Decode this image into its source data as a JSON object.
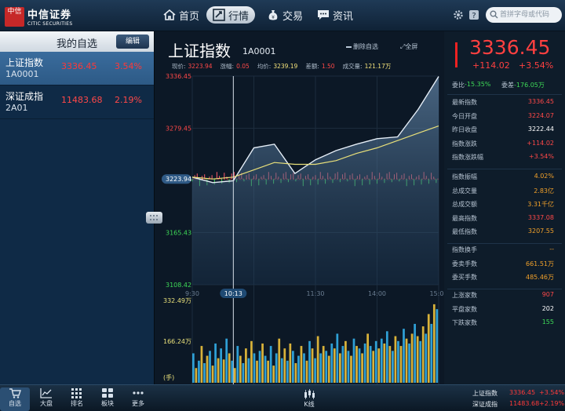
{
  "app": {
    "logo_seal": "中信",
    "brand_cn": "中信证券",
    "brand_en": "CITIC SECURITIES"
  },
  "nav": {
    "home": "首页",
    "market": "行情",
    "trade": "交易",
    "news": "资讯"
  },
  "search": {
    "placeholder": "首拼字母或代码"
  },
  "watchlist": {
    "title": "我的自选",
    "edit_label": "编辑",
    "items": [
      {
        "name": "上证指数",
        "code": "1A0001",
        "price": "3336.45",
        "change_pct": "3.54%"
      },
      {
        "name": "深证成指",
        "code": "2A01",
        "price": "11483.68",
        "change_pct": "2.19%"
      }
    ]
  },
  "quote": {
    "title": "上证指数",
    "code": "1A0001",
    "remove_fav": "删除自选",
    "fullscreen": "全屏",
    "stats": [
      {
        "label": "现价:",
        "value": "3223.94",
        "color": "#ff4848"
      },
      {
        "label": "涨幅:",
        "value": "0.05",
        "color": "#ff4848"
      },
      {
        "label": "均价:",
        "value": "3239.19",
        "color": "#f3e27a"
      },
      {
        "label": "差额:",
        "value": "1.50",
        "color": "#ff4848"
      },
      {
        "label": "成交量:",
        "value": "121.17万",
        "color": "#f3e27a"
      }
    ],
    "big_price": "3336.45",
    "change": "+114.02",
    "change_pct": "+3.54%"
  },
  "chart_data": {
    "type": "line",
    "title": "",
    "y_ticks": [
      {
        "label": "3336.45",
        "color": "#ff4848"
      },
      {
        "label": "3279.45",
        "color": "#ff4848"
      },
      {
        "label": "3223.94",
        "color": "#ffffff",
        "highlight": true
      },
      {
        "label": "3165.43",
        "color": "#3ed957"
      },
      {
        "label": "3108.42",
        "color": "#3ed957"
      }
    ],
    "x_ticks": [
      "9:30",
      "10:13",
      "11:30",
      "14:00",
      "15:00"
    ],
    "crosshair_time": "10:13",
    "ylim": [
      3108.42,
      3336.45
    ],
    "x_minutes": [
      0,
      20,
      40,
      60,
      80,
      100,
      120,
      140,
      160,
      180,
      200,
      220,
      240
    ],
    "series": [
      {
        "name": "",
        "values": [
          3226,
          3220,
          3222,
          3258,
          3262,
          3230,
          3245,
          3255,
          3262,
          3268,
          3270,
          3300,
          3336
        ]
      },
      {
        "name": "",
        "values": [
          3226,
          3224,
          3226,
          3234,
          3242,
          3240,
          3240,
          3244,
          3252,
          3258,
          3266,
          3274,
          3282
        ]
      }
    ],
    "volume": {
      "y_ticks": [
        "332.49万",
        "166.24万",
        "(手)"
      ],
      "ylim": [
        0,
        332.49
      ],
      "values": [
        120,
        60,
        90,
        150,
        80,
        110,
        130,
        70,
        160,
        100,
        140,
        95,
        180,
        120,
        90,
        60,
        150,
        110,
        80,
        140,
        100,
        170,
        120,
        90,
        130,
        160,
        110,
        90,
        150,
        70,
        120,
        180,
        100,
        140,
        90,
        160,
        130,
        80,
        110,
        150,
        120,
        90,
        170,
        140,
        100,
        190,
        120,
        150,
        130,
        110,
        160,
        140,
        200,
        120,
        150,
        170,
        130,
        110,
        180,
        150,
        140,
        120,
        160,
        200,
        150,
        130,
        170,
        140,
        180,
        160,
        210,
        150,
        130,
        190,
        170,
        150,
        220,
        180,
        160,
        200,
        240,
        190,
        170,
        230,
        200,
        280,
        240,
        320,
        300
      ]
    }
  },
  "panel": {
    "wei_bi_label": "委比",
    "wei_bi_value": "-15.35%",
    "wei_cha_label": "委差",
    "wei_cha_value": "-176.05万",
    "group1": [
      {
        "label": "最新指数",
        "value": "3336.45",
        "color": "#ff4848"
      },
      {
        "label": "今日开盘",
        "value": "3224.07",
        "color": "#ff4848"
      },
      {
        "label": "昨日收盘",
        "value": "3222.44",
        "color": "#ffffff"
      },
      {
        "label": "指数涨跌",
        "value": "+114.02",
        "color": "#ff4848"
      },
      {
        "label": "指数涨跌幅",
        "value": "+3.54%",
        "color": "#ff4848"
      }
    ],
    "group2": [
      {
        "label": "指数振幅",
        "value": "4.02%",
        "color": "#f0a02a"
      },
      {
        "label": "总成交量",
        "value": "2.83亿",
        "color": "#f0a02a"
      },
      {
        "label": "总成交额",
        "value": "3.31千亿",
        "color": "#f0a02a"
      },
      {
        "label": "最高指数",
        "value": "3337.08",
        "color": "#ff4848"
      },
      {
        "label": "最低指数",
        "value": "3207.55",
        "color": "#f0a02a"
      }
    ],
    "group3": [
      {
        "label": "指数换手",
        "value": "--",
        "color": "#f0a02a"
      },
      {
        "label": "委卖手数",
        "value": "661.51万",
        "color": "#f0a02a"
      },
      {
        "label": "委买手数",
        "value": "485.46万",
        "color": "#f0a02a"
      }
    ],
    "group4": [
      {
        "label": "上涨家数",
        "value": "907",
        "color": "#ff4848"
      },
      {
        "label": "平盘家数",
        "value": "202",
        "color": "#ffffff"
      },
      {
        "label": "下跌家数",
        "value": "155",
        "color": "#3ed957"
      }
    ]
  },
  "bottom": {
    "tabs": [
      "自选",
      "大盘",
      "排名",
      "板块",
      "更多"
    ],
    "kline": "K线",
    "indices": [
      {
        "name": "上证指数",
        "price": "3336.45",
        "pct": "+3.54%"
      },
      {
        "name": "深证成指",
        "price": "11483.68",
        "pct": "+2.19%"
      }
    ]
  }
}
